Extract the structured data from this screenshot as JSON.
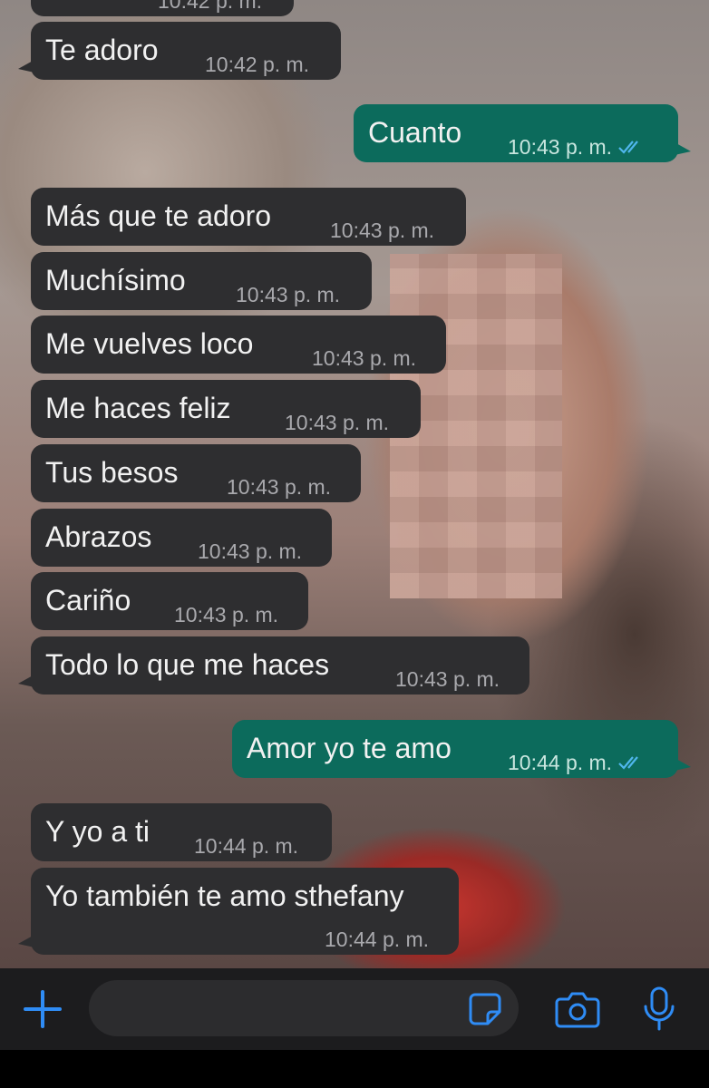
{
  "messages": [
    {
      "text": "",
      "time": "10:42 p. m.",
      "dir": "in"
    },
    {
      "text": "Te adoro",
      "time": "10:42 p. m.",
      "dir": "in"
    },
    {
      "text": "Cuanto",
      "time": "10:43 p. m.",
      "dir": "out",
      "read": true
    },
    {
      "text": "Más que te adoro",
      "time": "10:43 p. m.",
      "dir": "in"
    },
    {
      "text": "Muchísimo",
      "time": "10:43 p. m.",
      "dir": "in"
    },
    {
      "text": "Me vuelves loco",
      "time": "10:43 p. m.",
      "dir": "in"
    },
    {
      "text": "Me haces feliz",
      "time": "10:43 p. m.",
      "dir": "in"
    },
    {
      "text": "Tus besos",
      "time": "10:43 p. m.",
      "dir": "in"
    },
    {
      "text": "Abrazos",
      "time": "10:43 p. m.",
      "dir": "in"
    },
    {
      "text": "Cariño",
      "time": "10:43 p. m.",
      "dir": "in"
    },
    {
      "text": "Todo lo que me haces",
      "time": "10:43 p. m.",
      "dir": "in"
    },
    {
      "text": "Amor yo te amo",
      "time": "10:44 p. m.",
      "dir": "out",
      "read": true
    },
    {
      "text": "Y yo a ti",
      "time": "10:44 p. m.",
      "dir": "in"
    },
    {
      "text": "Yo también te amo sthefany",
      "time": "10:44 p. m.",
      "dir": "in"
    }
  ],
  "composer": {
    "input_value": "",
    "icons": [
      "plus-icon",
      "sticker-icon",
      "camera-icon",
      "microphone-icon"
    ],
    "accent_color": "#2f8cf5"
  },
  "colors": {
    "incoming_bubble": "#2e2e30",
    "outgoing_bubble": "#0c6b5c",
    "read_ticks": "#4fb6ec"
  }
}
